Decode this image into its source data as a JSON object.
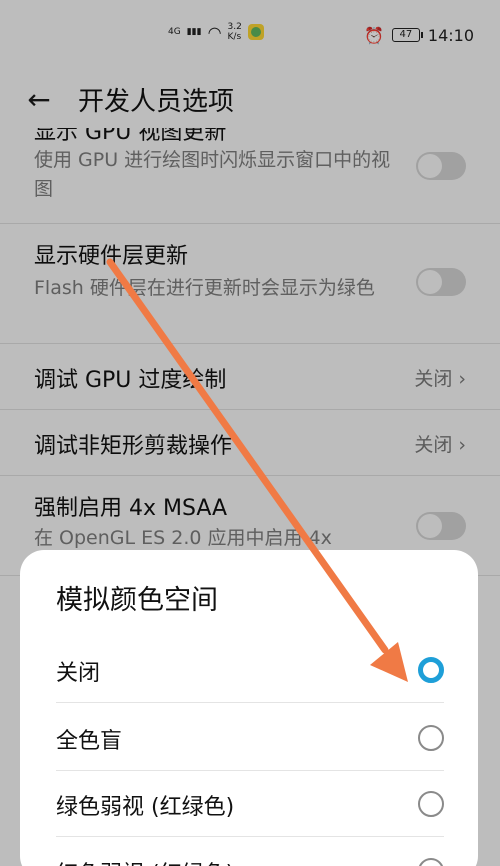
{
  "status_bar": {
    "network": "4G",
    "speed": "3.2",
    "speed_unit": "K/s",
    "battery": "47",
    "time": "14:10"
  },
  "header": {
    "title": "开发人员选项"
  },
  "settings": [
    {
      "title": "显示 GPU 视图更新",
      "subtitle": "使用 GPU 进行绘图时闪烁显示窗口中的视图",
      "control": "toggle"
    },
    {
      "title": "显示硬件层更新",
      "subtitle": "Flash 硬件层在进行更新时会显示为绿色",
      "control": "toggle"
    },
    {
      "title": "调试 GPU 过度绘制",
      "value": "关闭",
      "control": "value"
    },
    {
      "title": "调试非矩形剪裁操作",
      "value": "关闭",
      "control": "value"
    },
    {
      "title": "强制启用 4x MSAA",
      "subtitle": "在 OpenGL ES 2.0 应用中启用 4x",
      "control": "toggle"
    }
  ],
  "dialog": {
    "title": "模拟颜色空间",
    "options": [
      {
        "label": "关闭",
        "selected": true
      },
      {
        "label": "全色盲",
        "selected": false
      },
      {
        "label": "绿色弱视 (红绿色)",
        "selected": false
      },
      {
        "label": "红色弱视 (红绿色)",
        "selected": false
      }
    ]
  },
  "colors": {
    "accent": "#1e9fd8",
    "arrow": "#f07a45"
  }
}
